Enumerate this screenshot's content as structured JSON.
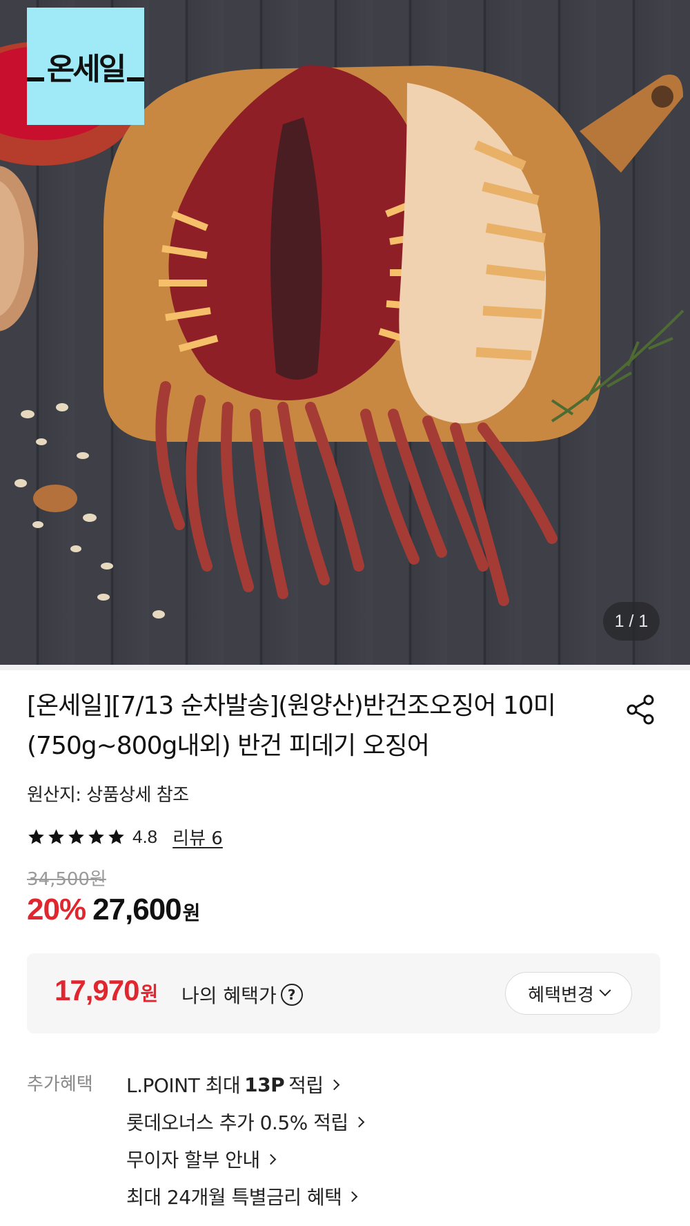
{
  "hero": {
    "badge_text": "온세일",
    "image_counter": "1 / 1",
    "colors": {
      "badge_bg": "#9feaf6",
      "wood_board": "#c98842",
      "squid": "#8e1f26"
    }
  },
  "product": {
    "title_line1": "[온세일][7/13 순차발송](원양산)반건조오징어 10미",
    "title_line2": "(750g~800g내외) 반건 피데기 오징어",
    "origin": "원산지: 상품상세 참조",
    "rating": "4.8",
    "stars": 5,
    "review_link": "리뷰 6",
    "original_price": "34,500원",
    "discount": "20%",
    "sale_price": "27,600",
    "currency": "원"
  },
  "benefit": {
    "price": "17,970",
    "currency": "원",
    "label": "나의 혜택가",
    "help_icon": "question-circle-icon",
    "change_button": "혜택변경"
  },
  "extra_benefits": {
    "label": "추가혜택",
    "items": [
      {
        "pre": "L.POINT 최대",
        "bold": "13P",
        "post": "적립"
      },
      {
        "text": "롯데오너스 추가 0.5% 적립"
      },
      {
        "text": "무이자 할부 안내"
      },
      {
        "text": "최대 24개월 특별금리 혜택"
      }
    ]
  },
  "colors": {
    "accent_red": "#e0262f",
    "text": "#111111",
    "muted": "#888888"
  }
}
